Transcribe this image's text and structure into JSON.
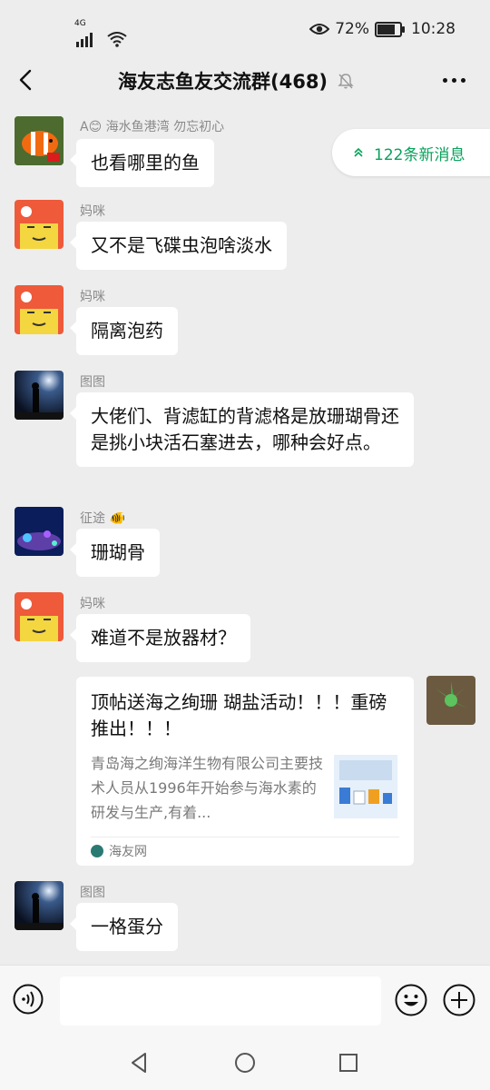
{
  "status_bar": {
    "network": "4G",
    "battery_percent": "72%",
    "battery_level": 0.72,
    "time": "10:28"
  },
  "header": {
    "title": "海友志鱼友交流群(468)",
    "icons": [
      "back-icon",
      "mute-bell-icon",
      "more-icon"
    ]
  },
  "new_messages_pill": "122条新消息",
  "messages": [
    {
      "sender": "A😊  海水鱼港湾  勿忘初心",
      "text": "也看哪里的鱼",
      "avatar": "clownfish-avatar"
    },
    {
      "sender": "妈咪",
      "text": "又不是飞碟虫泡啥淡水",
      "avatar": "cartoon-avatar"
    },
    {
      "sender": "妈咪",
      "text": "隔离泡药",
      "avatar": "cartoon-avatar"
    },
    {
      "sender": "图图",
      "text": "大佬们、背滤缸的背滤格是放珊瑚骨还是挑小块活石塞进去，哪种会好点。",
      "avatar": "night-figure-avatar"
    },
    {
      "sender": "征途 🐠",
      "text": "珊瑚骨",
      "avatar": "aquarium-avatar"
    },
    {
      "sender": "妈咪",
      "text": "难道不是放器材？",
      "avatar": "cartoon-avatar"
    },
    {
      "sender": "图图",
      "text": "一格蛋分",
      "avatar": "night-figure-avatar"
    }
  ],
  "shared_card": {
    "title": "顶帖送海之绚珊 瑚盐活动！！！重磅推出！！！",
    "description": "青岛海之绚海洋生物有限公司主要技术人员从1996年开始参与海水素的研发与生产,有着...",
    "source": "海友网",
    "avatar": "succulent-avatar"
  },
  "input_bar": {
    "placeholder": "",
    "icons": [
      "voice-icon",
      "emoji-icon",
      "plus-icon"
    ]
  },
  "system_nav": [
    "back-triangle-icon",
    "home-circle-icon",
    "recents-square-icon"
  ],
  "colors": {
    "background": "#ededed",
    "bubble": "#ffffff",
    "accent_green": "#07a35a"
  }
}
